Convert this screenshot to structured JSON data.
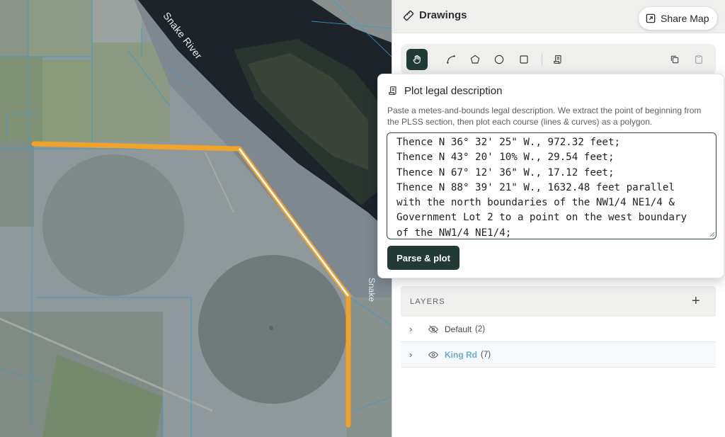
{
  "map": {
    "river_label": "Snake River",
    "river_label_small": "Snake",
    "drawn_line_color": "#f0a22a"
  },
  "panel": {
    "title": "Drawings",
    "title_icon": "ruler-icon"
  },
  "share_button": {
    "label": "Share Map",
    "icon": "share-icon"
  },
  "toolbar": {
    "tools": [
      {
        "name": "pan-tool",
        "icon": "hand-icon",
        "active": true
      },
      {
        "name": "line-tool",
        "icon": "line-curve-icon",
        "active": false
      },
      {
        "name": "polygon-tool",
        "icon": "pentagon-icon",
        "active": false
      },
      {
        "name": "circle-tool",
        "icon": "circle-icon",
        "active": false
      },
      {
        "name": "rectangle-tool",
        "icon": "square-icon",
        "active": false
      },
      {
        "name": "legal-description-tool",
        "icon": "scroll-icon",
        "active": false
      },
      {
        "name": "copy-tool",
        "icon": "copy-icon",
        "active": false
      },
      {
        "name": "paste-tool",
        "icon": "clipboard-icon",
        "active": false
      }
    ]
  },
  "legal_popover": {
    "title": "Plot legal description",
    "description": "Paste a metes-and-bounds legal description. We extract the point of beginning from the PLSS section, then plot each course (lines & curves) as a polygon.",
    "text": "Thence N 36° 32' 25\" W., 972.32 feet;\nThence N 43° 20' 10% W., 29.54 feet;\nThence N 67° 12' 36\" W., 17.12 feet;\nThence N 88° 39' 21\" W., 1632.48 feet parallel\nwith the north boundaries of the NW1/4 NE1/4 &\nGovernment Lot 2 to a point on the west boundary\nof the NW1/4 NE1/4;",
    "parse_button": "Parse & plot"
  },
  "layers": {
    "heading": "LAYERS",
    "add_symbol": "+",
    "items": [
      {
        "name": "Default",
        "count": "(2)",
        "visible": false,
        "selected": false
      },
      {
        "name": "King Rd",
        "count": "(7)",
        "visible": true,
        "selected": true
      }
    ]
  }
}
